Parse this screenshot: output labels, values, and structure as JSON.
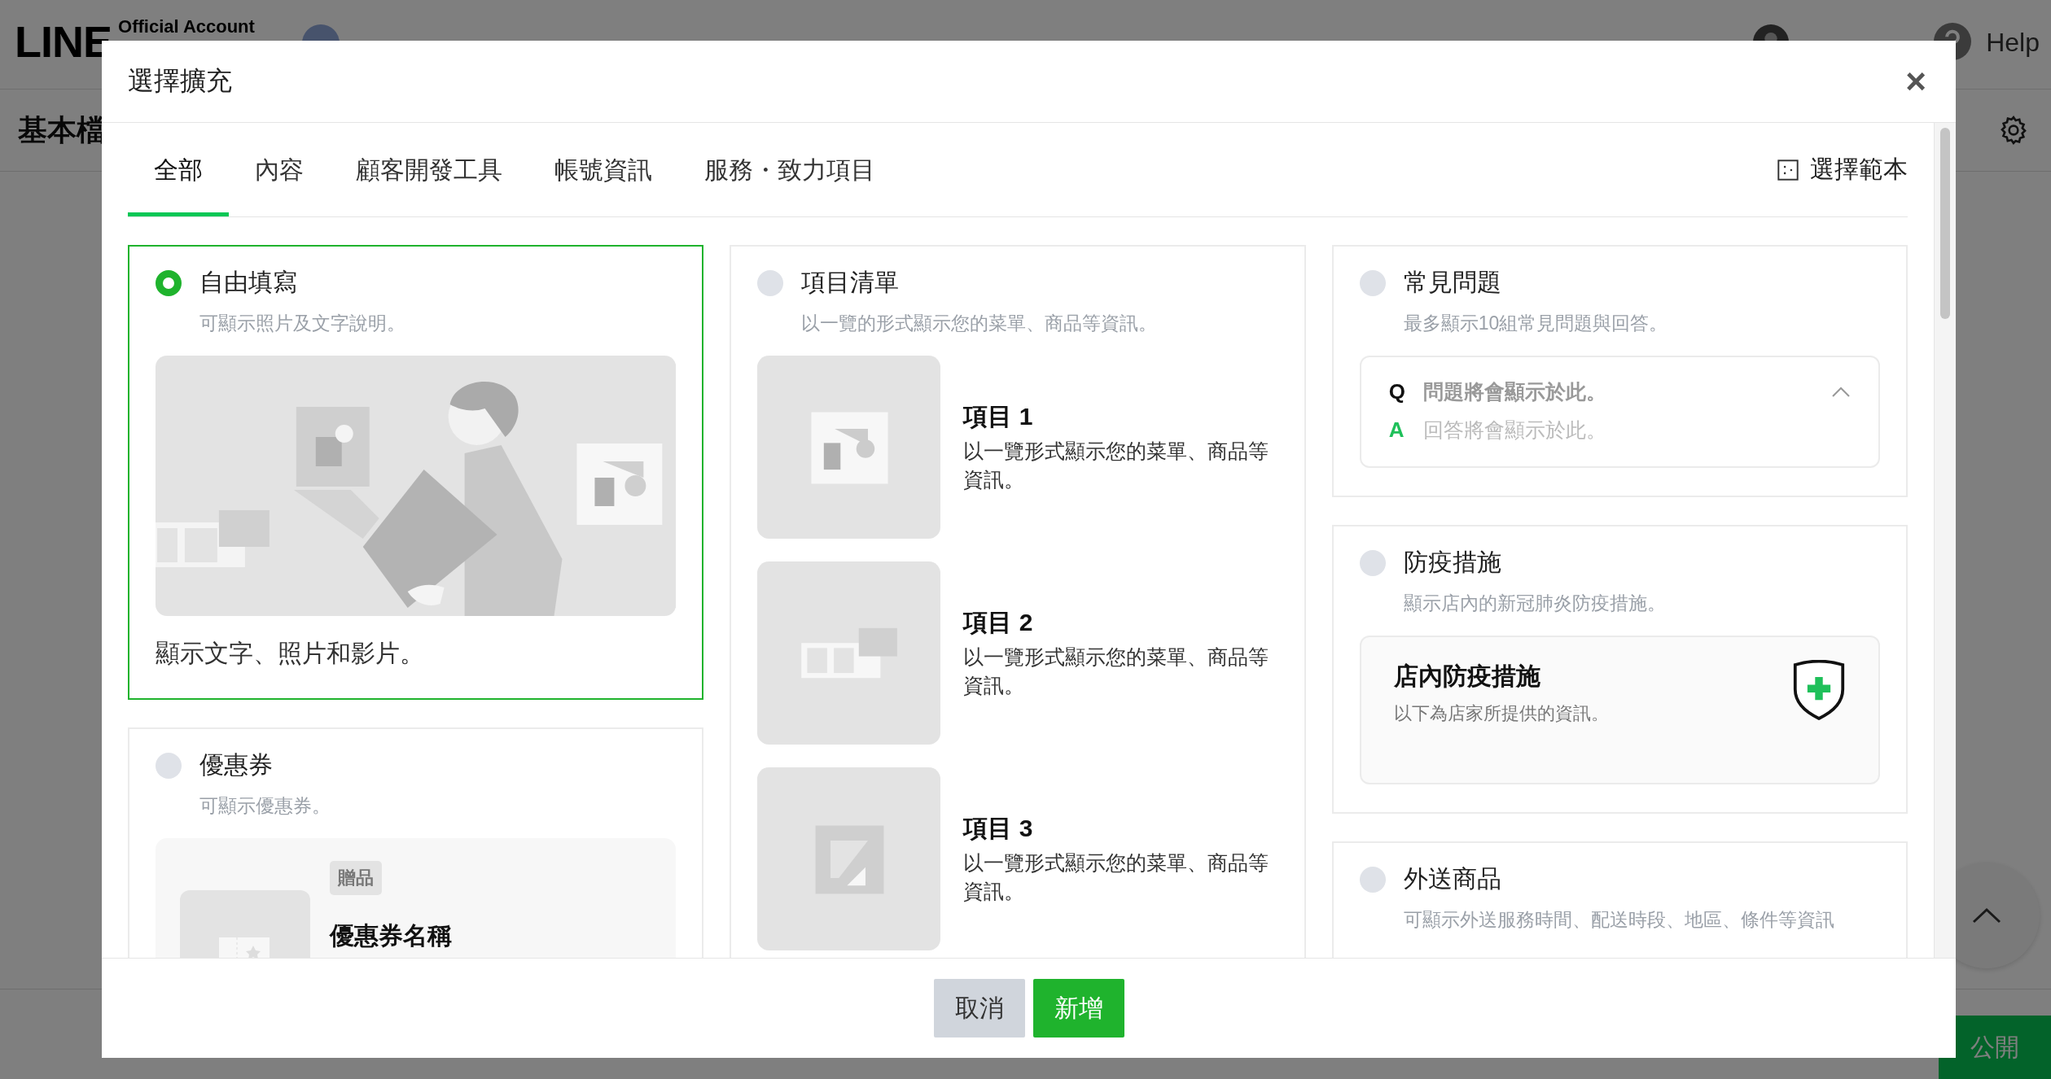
{
  "background_page": {
    "logo": "LINE",
    "logo_sub": "Official Account",
    "help": "Help",
    "page_title": "基本檔",
    "publish_button": "公開"
  },
  "dialog": {
    "title": "選擇擴充",
    "close": "×",
    "tabs": [
      {
        "label": "全部",
        "selected": true
      },
      {
        "label": "內容",
        "selected": false
      },
      {
        "label": "顧客開發工具",
        "selected": false
      },
      {
        "label": "帳號資訊",
        "selected": false
      },
      {
        "label": "服務・致力項目",
        "selected": false
      }
    ],
    "template_link": "選擇範本",
    "columns": [
      [
        {
          "kind": "freeform",
          "title": "自由填寫",
          "description": "可顯示照片及文字說明。",
          "selected": true,
          "caption": "顯示文字、照片和影片。"
        },
        {
          "kind": "coupon",
          "title": "優惠券",
          "description": "可顯示優惠券。",
          "selected": false,
          "tag": "贈品",
          "coupon_name": "優惠券名稱"
        }
      ],
      [
        {
          "kind": "list",
          "title": "項目清單",
          "description": "以一覽的形式顯示您的菜單、商品等資訊。",
          "selected": false,
          "items": [
            {
              "title": "項目 1",
              "text": "以一覽形式顯示您的菜單、商品等資訊。"
            },
            {
              "title": "項目 2",
              "text": "以一覽形式顯示您的菜單、商品等資訊。"
            },
            {
              "title": "項目 3",
              "text": "以一覽形式顯示您的菜單、商品等資訊。"
            }
          ]
        }
      ],
      [
        {
          "kind": "faq",
          "title": "常見問題",
          "description": "最多顯示10組常見問題與回答。",
          "selected": false,
          "q_mark": "Q",
          "question": "問題將會顯示於此。",
          "a_mark": "A",
          "answer": "回答將會顯示於此。",
          "expanded": true
        },
        {
          "kind": "covid",
          "title": "防疫措施",
          "description": "顯示店內的新冠肺炎防疫措施。",
          "selected": false,
          "box_title": "店內防疫措施",
          "box_text": "以下為店家所提供的資訊。"
        },
        {
          "kind": "delivery",
          "title": "外送商品",
          "description": "可顯示外送服務時間、配送時段、地區、條件等資訊",
          "selected": false
        }
      ]
    ],
    "buttons": [
      {
        "label": "取消",
        "kind": "secondary"
      },
      {
        "label": "新增",
        "kind": "primary"
      }
    ]
  }
}
